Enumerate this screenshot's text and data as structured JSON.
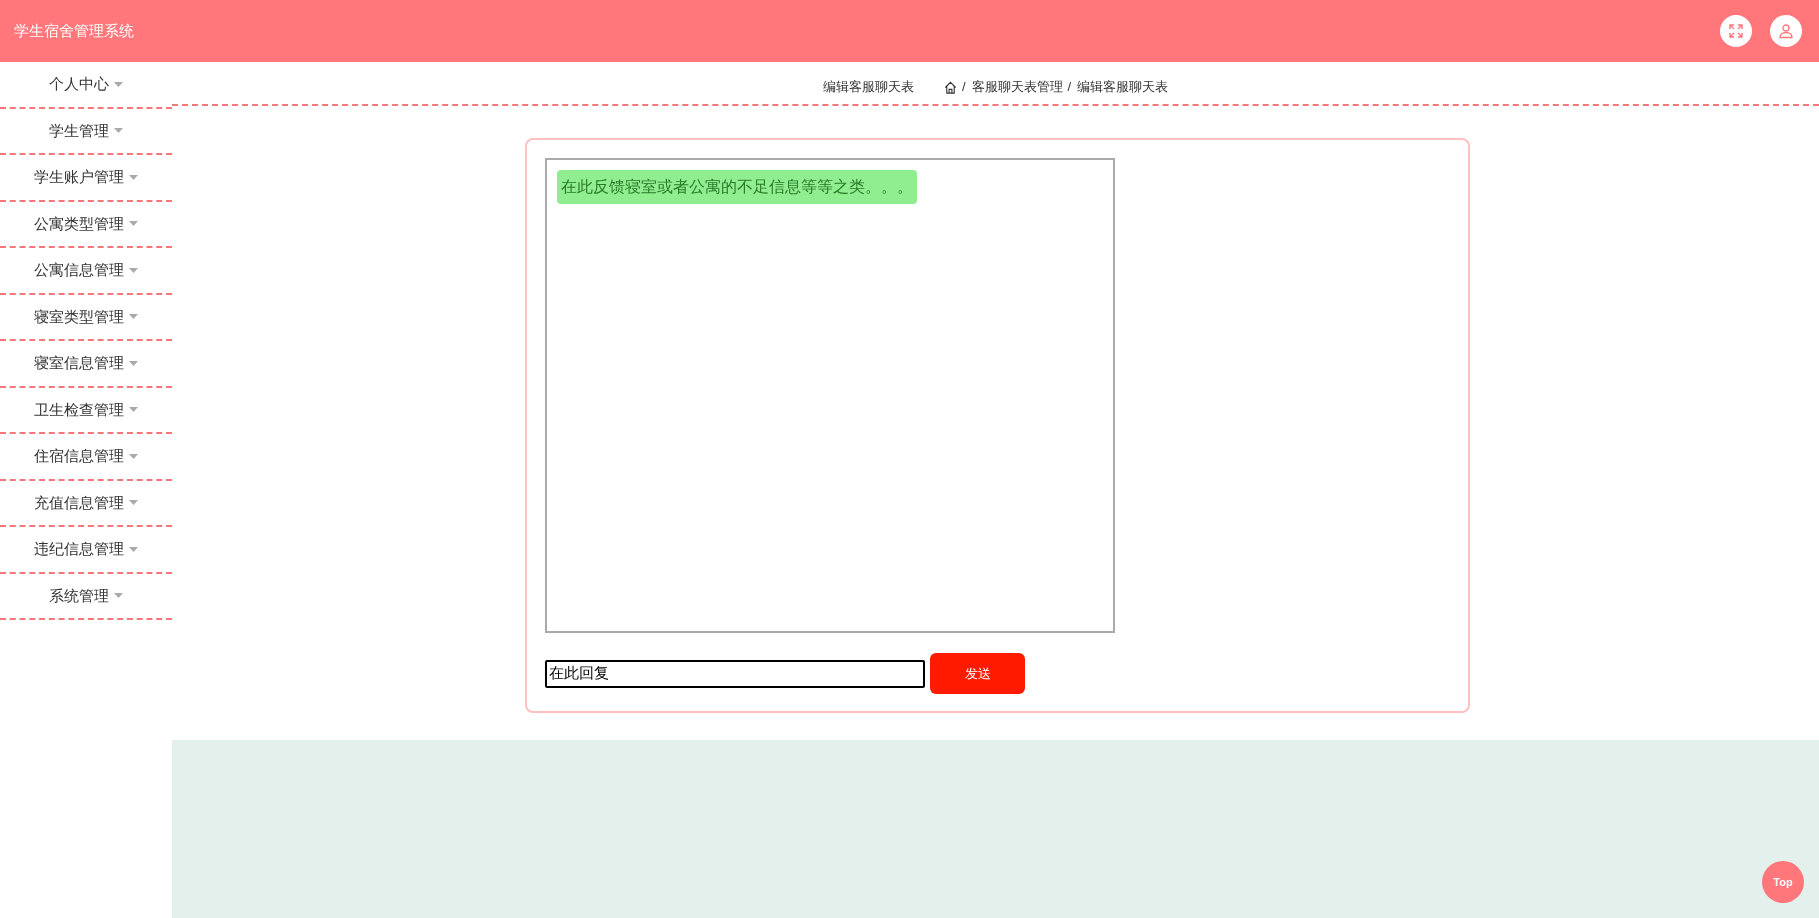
{
  "header": {
    "title": "学生宿舍管理系统"
  },
  "sidebar": {
    "items": [
      {
        "label": "个人中心"
      },
      {
        "label": "学生管理"
      },
      {
        "label": "学生账户管理"
      },
      {
        "label": "公寓类型管理"
      },
      {
        "label": "公寓信息管理"
      },
      {
        "label": "寝室类型管理"
      },
      {
        "label": "寝室信息管理"
      },
      {
        "label": "卫生检查管理"
      },
      {
        "label": "住宿信息管理"
      },
      {
        "label": "充值信息管理"
      },
      {
        "label": "违纪信息管理"
      },
      {
        "label": "系统管理"
      }
    ]
  },
  "page_title": "编辑客服聊天表",
  "breadcrumb": [
    {
      "separator": "/",
      "label": "客服聊天表管理"
    },
    {
      "separator": "/",
      "label": "编辑客服聊天表"
    }
  ],
  "chat": {
    "messages": [
      {
        "text": "在此反馈寝室或者公寓的不足信息等等之类。。。"
      }
    ],
    "reply": {
      "value": "在此回复"
    },
    "send_button": "发送"
  },
  "top_button": "Top"
}
